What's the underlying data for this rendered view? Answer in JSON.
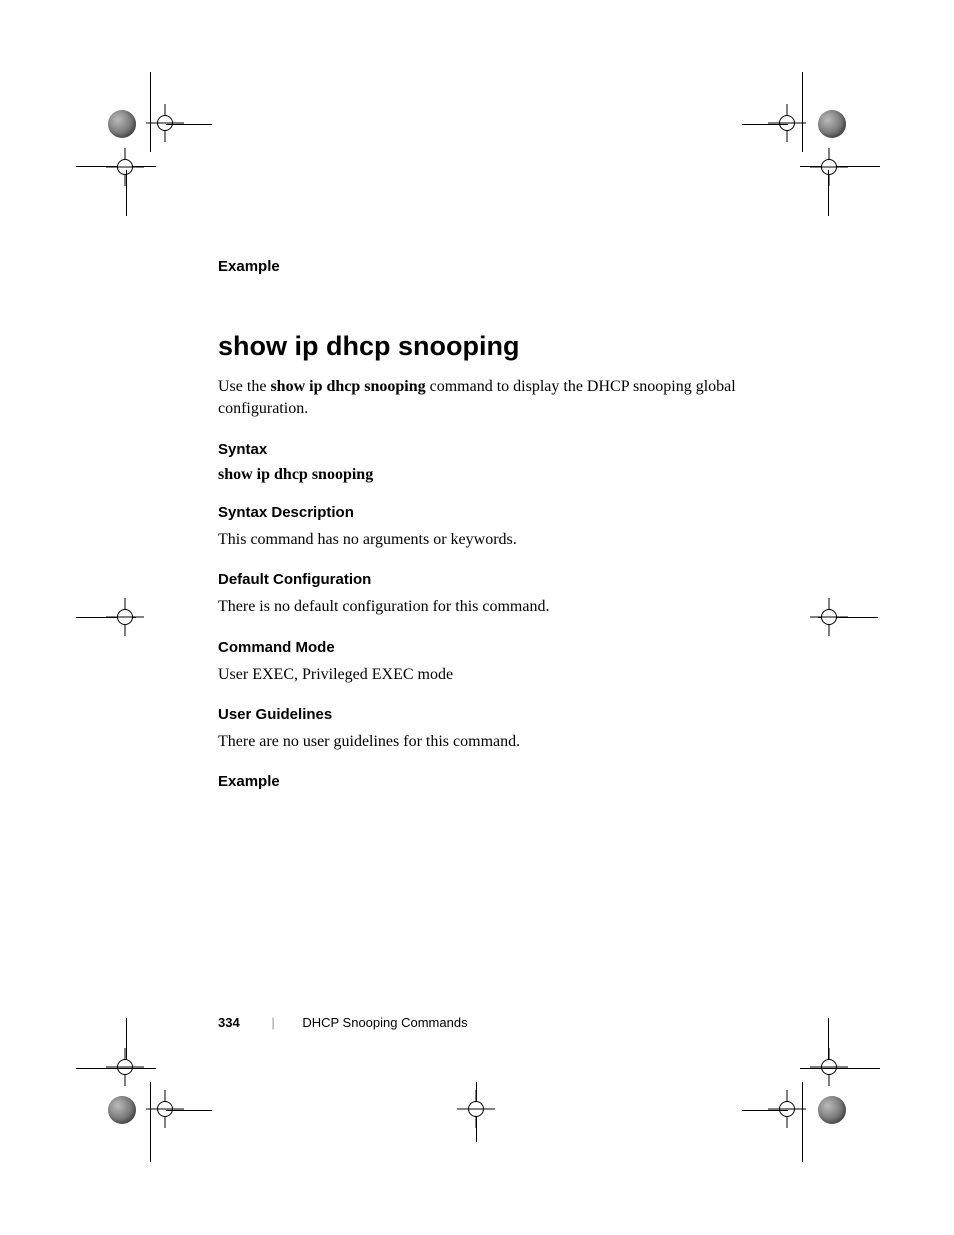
{
  "sections": {
    "example1_heading": "Example",
    "title": "show ip dhcp snooping",
    "intro_pre": "Use the ",
    "intro_bold": "show ip dhcp snooping",
    "intro_post": " command to display the DHCP snooping global configuration.",
    "syntax_heading": "Syntax",
    "syntax_line": "show ip dhcp snooping",
    "syntax_desc_heading": "Syntax Description",
    "syntax_desc_body": "This command has no arguments or keywords.",
    "default_heading": "Default Configuration",
    "default_body": "There is no default configuration for this command.",
    "mode_heading": "Command Mode",
    "mode_body": "User EXEC, Privileged EXEC mode",
    "guidelines_heading": "User Guidelines",
    "guidelines_body": "There are no user guidelines for this command.",
    "example2_heading": "Example"
  },
  "footer": {
    "page": "334",
    "divider": "|",
    "chapter": "DHCP Snooping Commands"
  }
}
